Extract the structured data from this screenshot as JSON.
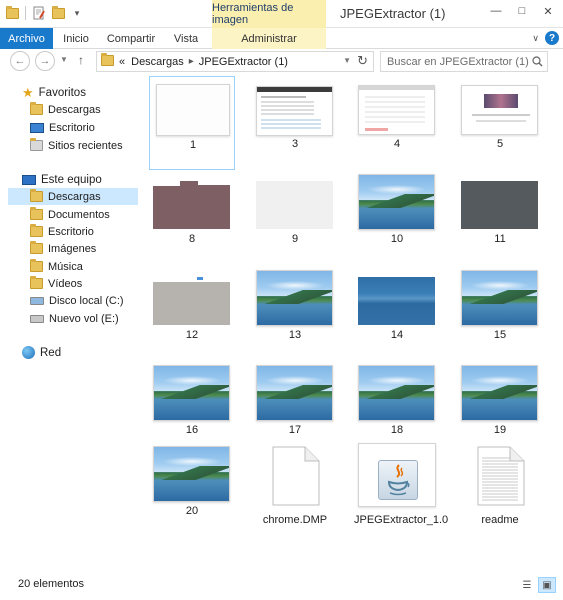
{
  "window": {
    "title": "JPEGExtractor (1)",
    "context_tab_title": "Herramientas de imagen"
  },
  "ribbon": {
    "tabs": [
      "Archivo",
      "Inicio",
      "Compartir",
      "Vista",
      "Administrar"
    ]
  },
  "address": {
    "overflow": "«",
    "crumbs": [
      "Descargas",
      "JPEGExtractor (1)"
    ],
    "search_placeholder": "Buscar en JPEGExtractor (1)"
  },
  "nav": {
    "favorites_label": "Favoritos",
    "favorites": [
      "Descargas",
      "Escritorio",
      "Sitios recientes"
    ],
    "pc_label": "Este equipo",
    "pc_items": [
      "Descargas",
      "Documentos",
      "Escritorio",
      "Imágenes",
      "Música",
      "Vídeos",
      "Disco local (C:)",
      "Nuevo vol (E:)"
    ],
    "network_label": "Red",
    "selected": "Descargas"
  },
  "files": [
    {
      "name": "1",
      "kind": "blank"
    },
    {
      "name": "3",
      "kind": "webpage"
    },
    {
      "name": "4",
      "kind": "webpage-light"
    },
    {
      "name": "5",
      "kind": "webpage-banner"
    },
    {
      "name": "8",
      "kind": "maroon"
    },
    {
      "name": "9",
      "kind": "light-gray"
    },
    {
      "name": "10",
      "kind": "landscape"
    },
    {
      "name": "11",
      "kind": "dark-gray"
    },
    {
      "name": "12",
      "kind": "gray"
    },
    {
      "name": "13",
      "kind": "landscape"
    },
    {
      "name": "14",
      "kind": "blue-strip"
    },
    {
      "name": "15",
      "kind": "landscape"
    },
    {
      "name": "16",
      "kind": "landscape"
    },
    {
      "name": "17",
      "kind": "landscape"
    },
    {
      "name": "18",
      "kind": "landscape"
    },
    {
      "name": "19",
      "kind": "landscape"
    },
    {
      "name": "20",
      "kind": "landscape"
    },
    {
      "name": "chrome.DMP",
      "kind": "doc"
    },
    {
      "name": "JPEGExtractor_1.0",
      "kind": "java"
    },
    {
      "name": "readme",
      "kind": "text"
    }
  ],
  "status": {
    "item_count": "20 elementos"
  },
  "colors": {
    "accent": "#1979ca",
    "selection": "#cce8ff",
    "context_tab": "#fbefb0"
  }
}
